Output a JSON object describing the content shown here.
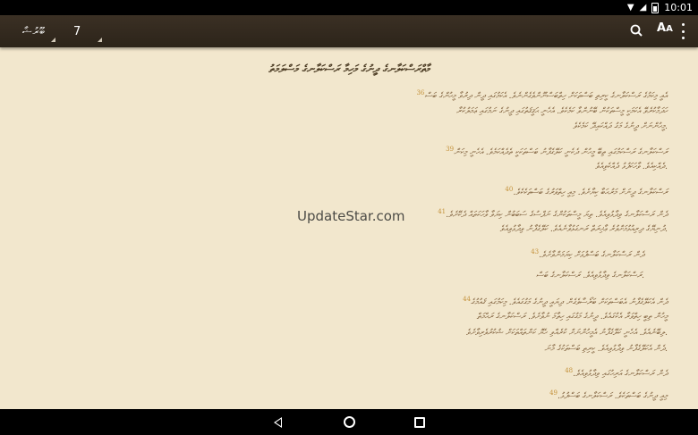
{
  "status_bar": {
    "time": "10:01"
  },
  "app_bar": {
    "book": "ބޫރުޝާ",
    "chapter": "7",
    "font_button_large": "A",
    "font_button_small": "A"
  },
  "content": {
    "heading": "މާތްރަސްކަލާނގެ ދީނުގެ މަހިމާ ރަސްކަލާނގެ މަސްލަމަތު",
    "verses": [
      {
        "number": "36",
        "text": "އެއީ މިކަމުގެ ރަސްކަލާނގެ ކީރިތި ބަސްތަކަށް ހިތްބަސްނޫންވެގެންނެވެ. އެކަމުގައި ދީން ދިރުވާ މީހުންގެ ބަސް"
      },
      {
        "number": "",
        "text": "ހަދަމާކުރެވޭ އެކަމަކީ މީސްތަކުން ބޭނުންވާ ކަމެކެވެ. އެހެނީ ޙަޤީޤަތުގައި ދީނުގެ ނަމުގައި ޢަމަލުކުރާ"
      },
      {
        "number": "",
        "text": "މީހުންނަށް ދީނުގެ މަގު ދައްކައިދޭ ކަމެކެވެ."
      },
      {
        "number": "39",
        "text": "ރަސްކަލާނގެ ރަސްކަމުގައި ތިބޭ މީހުން ދެކެނީ ކަލޭގެފާނު ބަސްތަކަކީ ތެދެއްކަމެވެ. އެހެނީ މިކަން"
      },
      {
        "number": "",
        "text": "ދެއްކިއެވެ. ވާހަކަފުޅު ދެއްކެވިއެވެ."
      },
      {
        "number": "40",
        "text": "ރަސްކަލާނގެ ދީނަށް މަރުޙަބާ ކިޔާށެވެ. މިއީ ހިތްވަރުގެ ބަސްތަކެކެވެ."
      },
      {
        "number": "41",
        "text": "ދެން ރަސްކަލާނގެ ވިދާޅުވިއެވެ. ތިޔަ މީސްތަކުންގެ ނަފްސުގެ ސަބަބުން ކިޔަވާ ވާހަކަތައް ދެކޭށެވެ."
      },
      {
        "number": "",
        "text": "ދުނިޔޭގެ ދިރިއުޅުމަށްވުރެ ޢާޚިރަތް ރަނގަޅުވާނެއެވެ. ކަލޭގެފާނު ވިދާޅުވިއެވެ."
      },
      {
        "number": "43",
        "text": "ދެން ރަސްކަލާނގެ ބަސްފުޅަށް ކިޔަމަންވާށެވެ."
      },
      {
        "number": "",
        "text": "ރަސްކަލާނގެ ވިދާޅުވިއެވެ. ރަސްކަލާނގެ ބަސް."
      },
      {
        "number": "44",
        "text": "ދެން އެކަލޭގެފާނު އެބަސްތަކަށް ބަރޯސާވެގެން ދިޔައީ ދީނުގެ މަގުގައެވެ. މިކަމުގައި ޤައުމުގެ"
      },
      {
        "number": "",
        "text": "މީހުން ތިބީ ހިތްވަރާ އެކުގައެވެ. ދީނުގެ މަގުގައި ހިތާމަ ނުވާށެވެ. ރަސްކަލާނގެ ރަޙްމަތް"
      },
      {
        "number": "",
        "text": "ލިބޭނެއެވެ. އެހެނީ ކަލޭގެފާނު އެމީހުންނަށް ކުރެއްވި ހެޔޮ ކަންތައްތަކަށް ޝުކުރުވެރިވާށެވެ."
      },
      {
        "number": "",
        "text": "ދެން އެކަލޭގެފާނު ވިދާޅުވިއެވެ. ކީރިތި ބަސްތަކުގެ މާނަ."
      },
      {
        "number": "48",
        "text": "ދެން ރަސްކަލާނގެ އަރިހުގައި ވިދާޅުވިއެވެ."
      },
      {
        "number": "49",
        "text": "މިއީ ދީނުގެ ބަސްތަކެވެ. ރަސްކަލާނގެ ބަސްފުޅު."
      }
    ]
  },
  "watermark": "UpdateStar.com"
}
